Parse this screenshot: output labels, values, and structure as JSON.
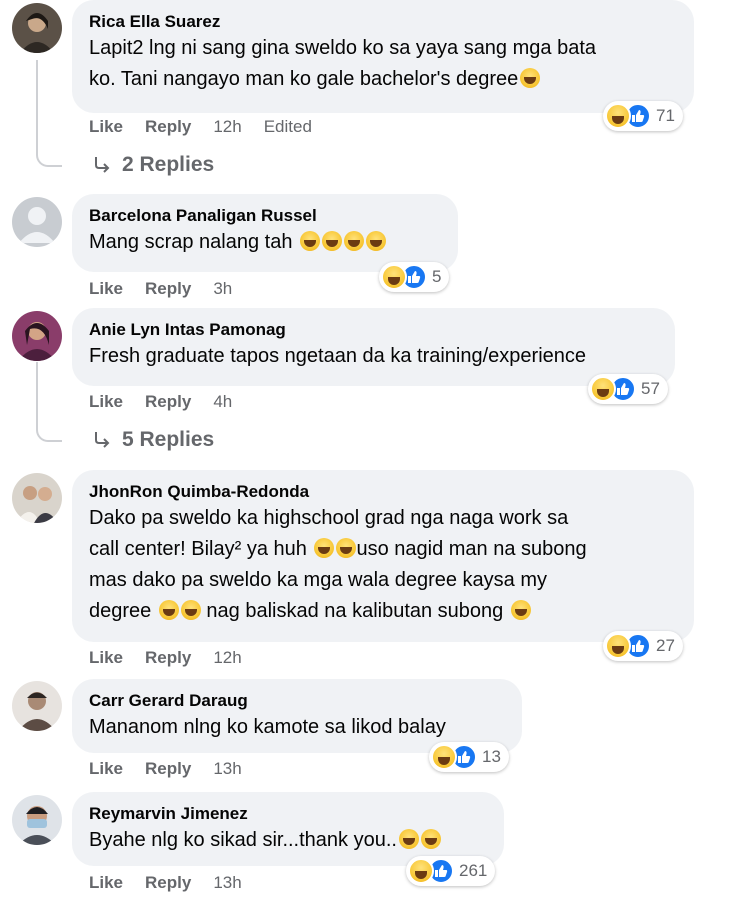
{
  "colors": {
    "bubble": "#f0f2f5",
    "meta_text": "#65676b",
    "like_blue": "#1877f2"
  },
  "comments": [
    {
      "author": "Rica Ella Suarez",
      "lines": [
        "Lapit2 lng ni sang gina sweldo ko sa yaya sang mga bata",
        "ko. Tani nangayo man ko gale bachelor's degree"
      ],
      "emoji_after_last": 1,
      "like": "Like",
      "reply": "Reply",
      "time": "12h",
      "edited": "Edited",
      "reactions": [
        "haha-icon",
        "like-icon"
      ],
      "reaction_count": "71",
      "replies": "2 Replies"
    },
    {
      "author": "Barcelona Panaligan Russel",
      "lines": [
        "Mang scrap nalang tah"
      ],
      "emoji_after_last": 4,
      "like": "Like",
      "reply": "Reply",
      "time": "3h",
      "reactions": [
        "haha-icon",
        "like-icon"
      ],
      "reaction_count": "5"
    },
    {
      "author": "Anie Lyn Intas Pamonag",
      "lines": [
        "Fresh graduate tapos ngetaan da ka training/experience"
      ],
      "like": "Like",
      "reply": "Reply",
      "time": "4h",
      "reactions": [
        "haha-icon",
        "like-icon"
      ],
      "reaction_count": "57",
      "replies": "5 Replies"
    },
    {
      "author": "JhonRon Quimba-Redonda",
      "lines": [
        "Dako pa sweldo ka highschool grad nga naga work sa",
        "call center! Bilay² ya huh",
        "uso nagid man na subong",
        "mas dako pa sweldo ka mga wala degree kaysa my",
        "degree",
        "nag baliskad na kalibutan subong"
      ],
      "like": "Like",
      "reply": "Reply",
      "time": "12h",
      "reactions": [
        "haha-icon",
        "like-icon"
      ],
      "reaction_count": "27"
    },
    {
      "author": "Carr Gerard Daraug",
      "lines": [
        "Mananom nlng ko kamote sa likod balay"
      ],
      "like": "Like",
      "reply": "Reply",
      "time": "13h",
      "reactions": [
        "haha-icon",
        "like-icon"
      ],
      "reaction_count": "13"
    },
    {
      "author": "Reymarvin Jimenez",
      "lines": [
        "Byahe nlg ko sikad sir...thank you.."
      ],
      "emoji_after_last": 2,
      "like": "Like",
      "reply": "Reply",
      "time": "13h",
      "reactions": [
        "haha-icon",
        "like-icon"
      ],
      "reaction_count": "261"
    }
  ]
}
